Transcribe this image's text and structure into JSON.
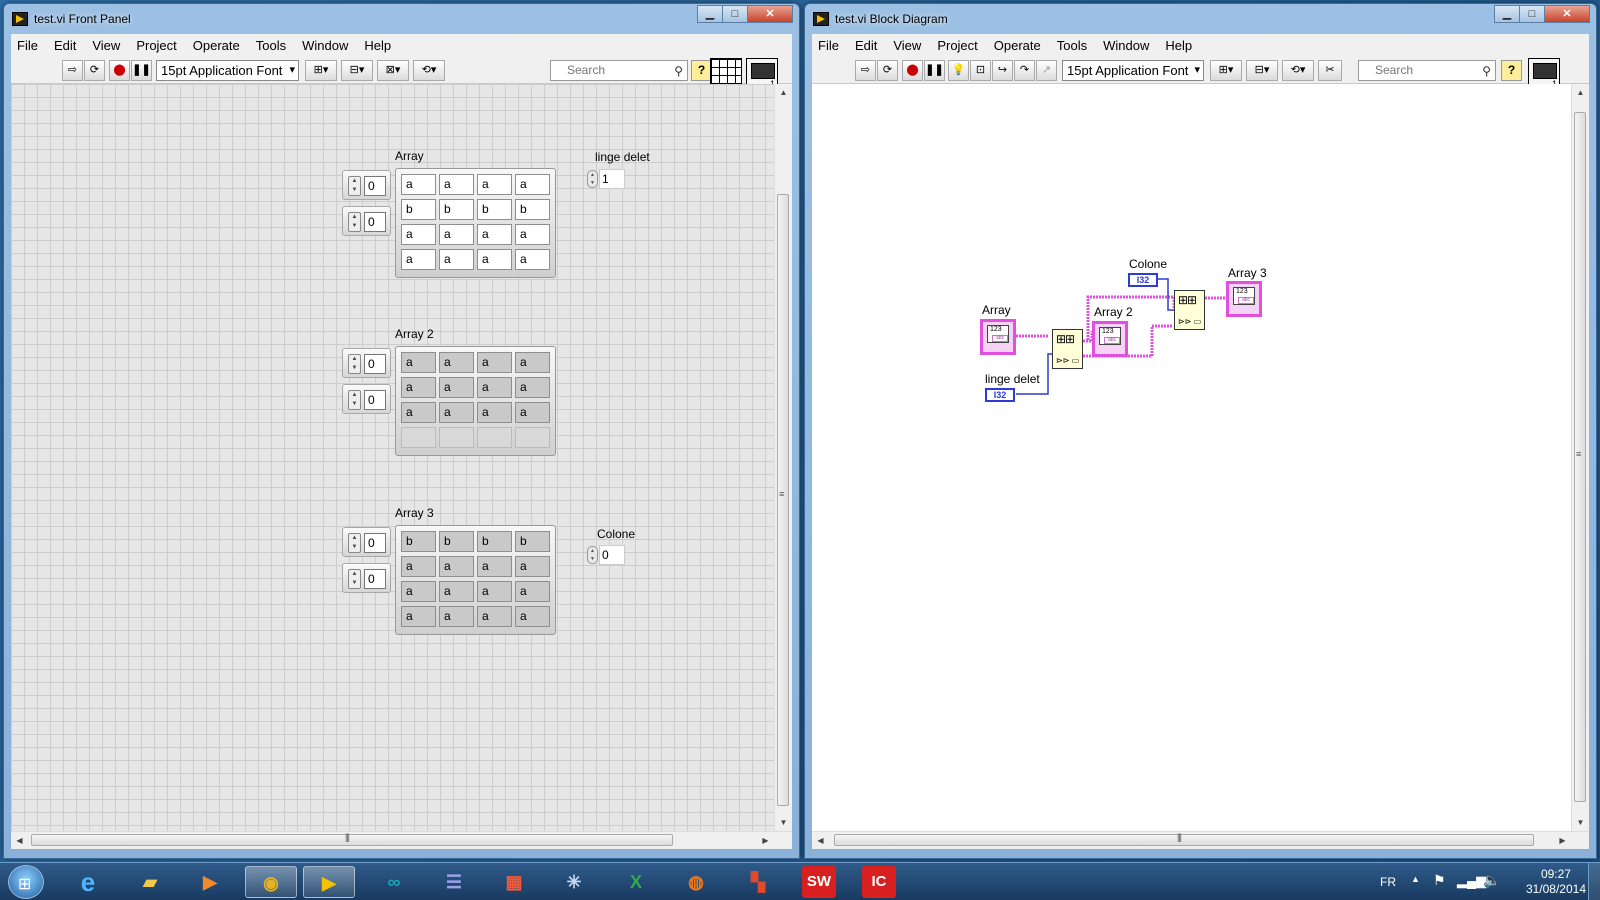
{
  "front_panel": {
    "title": "test.vi Front Panel",
    "window_buttons": {
      "minimize": "▁",
      "maximize": "□",
      "close": "✕"
    },
    "menu": [
      "File",
      "Edit",
      "View",
      "Project",
      "Operate",
      "Tools",
      "Window",
      "Help"
    ],
    "toolbar": {
      "font_label": "15pt Application Font",
      "search_placeholder": "Search",
      "help_label": "?"
    },
    "controls": {
      "array1": {
        "label": "Array",
        "index_row": "0",
        "index_col": "0",
        "cells": [
          [
            "a",
            "a",
            "a",
            "a"
          ],
          [
            "b",
            "b",
            "b",
            "b"
          ],
          [
            "a",
            "a",
            "a",
            "a"
          ],
          [
            "a",
            "a",
            "a",
            "a"
          ]
        ]
      },
      "array2": {
        "label": "Array 2",
        "index_row": "0",
        "index_col": "0",
        "cells": [
          [
            "a",
            "a",
            "a",
            "a"
          ],
          [
            "a",
            "a",
            "a",
            "a"
          ],
          [
            "a",
            "a",
            "a",
            "a"
          ],
          [
            "",
            "",
            "",
            ""
          ]
        ]
      },
      "array3": {
        "label": "Array 3",
        "index_row": "0",
        "index_col": "0",
        "cells": [
          [
            "b",
            "b",
            "b",
            "b"
          ],
          [
            "a",
            "a",
            "a",
            "a"
          ],
          [
            "a",
            "a",
            "a",
            "a"
          ],
          [
            "a",
            "a",
            "a",
            "a"
          ]
        ]
      },
      "linge_delet": {
        "label": "linge delet",
        "value": "1"
      },
      "colone": {
        "label": "Colone",
        "value": "0"
      }
    },
    "scroll_grip": "|||"
  },
  "block_diagram": {
    "title": "test.vi Block Diagram",
    "window_buttons": {
      "minimize": "▁",
      "maximize": "□",
      "close": "✕"
    },
    "menu": [
      "File",
      "Edit",
      "View",
      "Project",
      "Operate",
      "Tools",
      "Window",
      "Help"
    ],
    "toolbar": {
      "font_label": "15pt Application Font",
      "search_placeholder": "Search",
      "help_label": "?"
    },
    "nodes": {
      "array_label": "Array",
      "array2_label": "Array 2",
      "array3_label": "Array 3",
      "colone_label": "Colone",
      "linge_delet_label": "linge delet",
      "i32_text": "I32",
      "numeric_text": "123",
      "string_text": "abc"
    },
    "scroll_grip": "|||"
  },
  "taskbar": {
    "apps": [
      "internet-explorer",
      "file-explorer",
      "media-player",
      "chrome",
      "labview",
      "arduino",
      "app-stack",
      "app-grid",
      "app-network",
      "excel",
      "firefox",
      "app-blocks",
      "solidworks",
      "ic-app"
    ],
    "badge_sw": "SW",
    "badge_ic": "IC",
    "language": "FR",
    "time": "09:27",
    "date": "31/08/2014"
  },
  "colors": {
    "wire_pink": "#e050e0",
    "wire_blue": "#2e3bd6",
    "node_fill": "#ffffd8"
  }
}
